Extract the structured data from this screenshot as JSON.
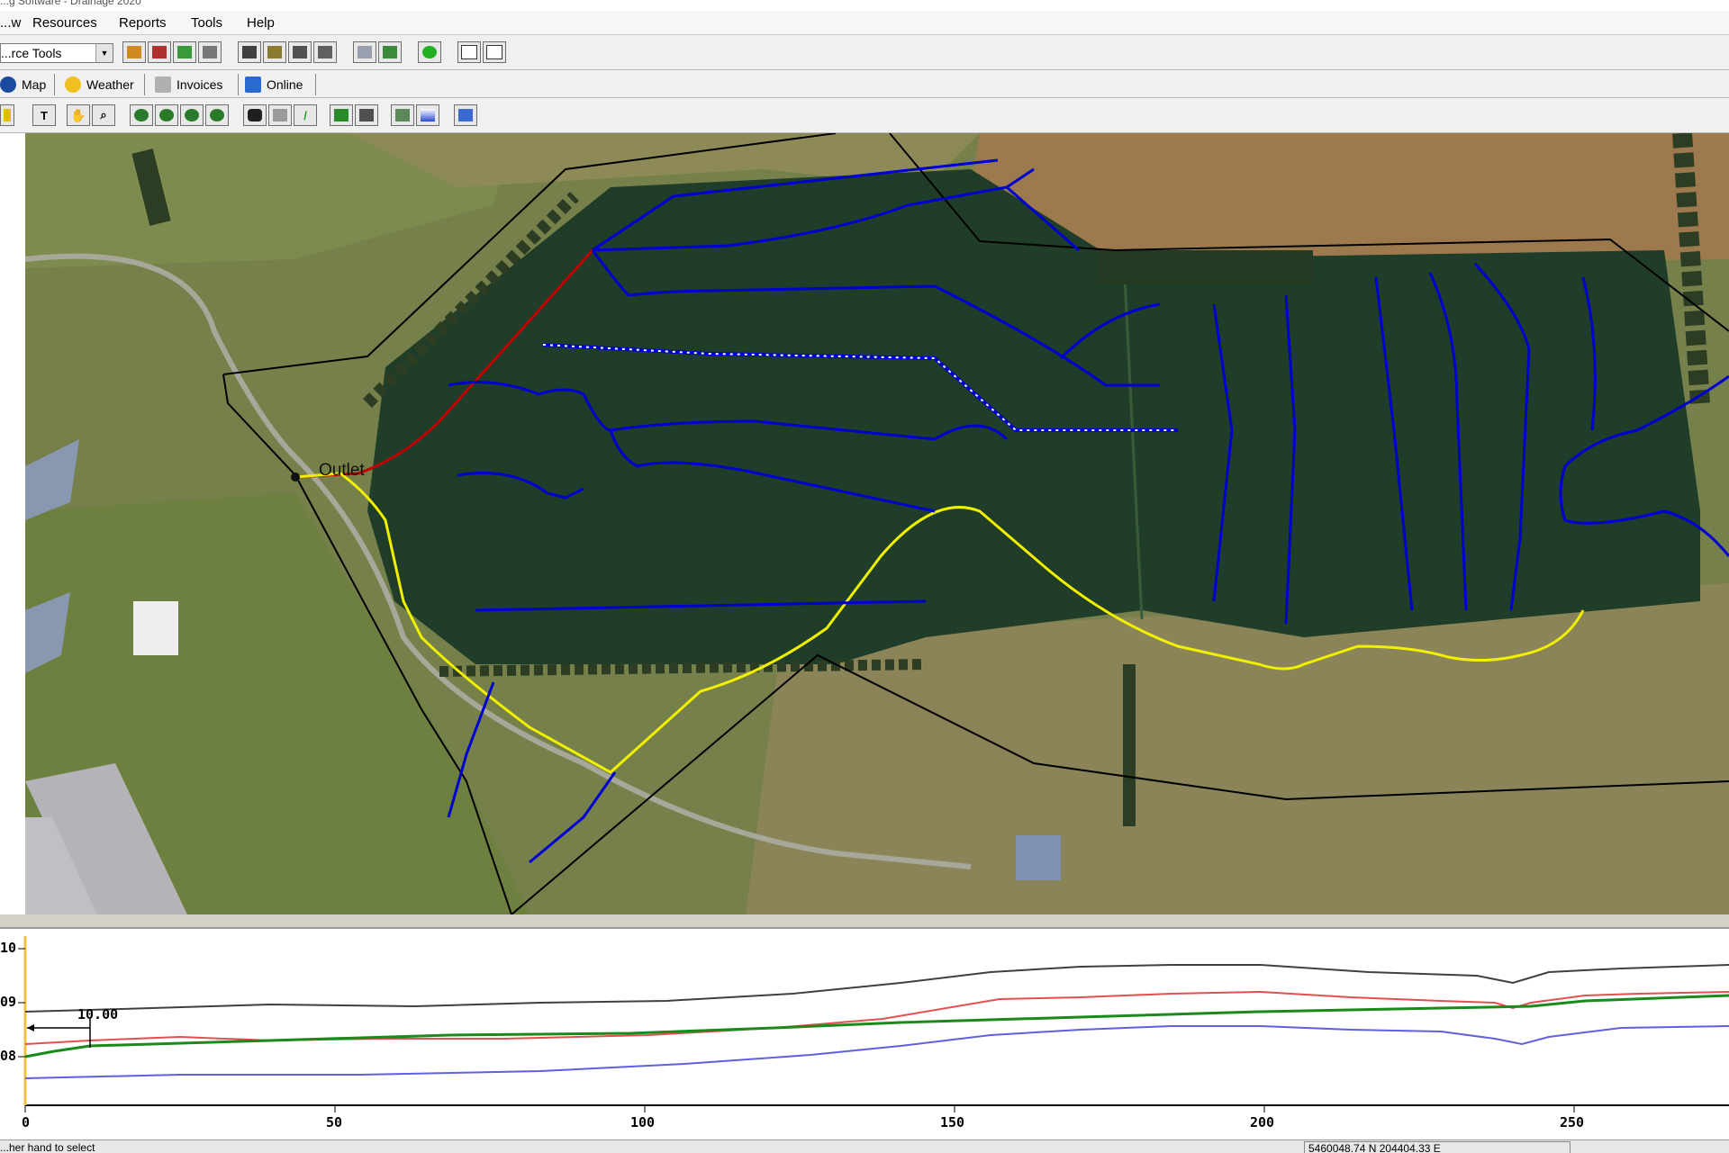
{
  "window": {
    "title": "...g Software - Drainage 2020"
  },
  "menu": {
    "items": [
      "...w",
      "Resources",
      "Reports",
      "Tools",
      "Help"
    ]
  },
  "toolbar": {
    "resource_combo": "...rce Tools"
  },
  "tabs": [
    {
      "label": "Map",
      "icon": "globe-icon"
    },
    {
      "label": "Weather",
      "icon": "weather-icon"
    },
    {
      "label": "Invoices",
      "icon": "invoice-icon"
    },
    {
      "label": "Online",
      "icon": "online-icon"
    }
  ],
  "map": {
    "outlet_label": "Outlet"
  },
  "profile": {
    "y_ticks": [
      "10",
      "09",
      "08"
    ],
    "x_ticks": [
      "0",
      "50",
      "100",
      "150",
      "200",
      "250"
    ],
    "measure_label": "10.00"
  },
  "status": {
    "left_text": "...her hand to select",
    "coordinates": "5460048.74 N   204404.33 E"
  },
  "colors": {
    "drain_main": "#0000d0",
    "drain_red": "#c00000",
    "boundary_yellow": "#f0f000",
    "profile_gray": "#404040",
    "profile_red": "#e05050",
    "profile_green": "#1a8a1a",
    "profile_blue": "#6060e0"
  }
}
